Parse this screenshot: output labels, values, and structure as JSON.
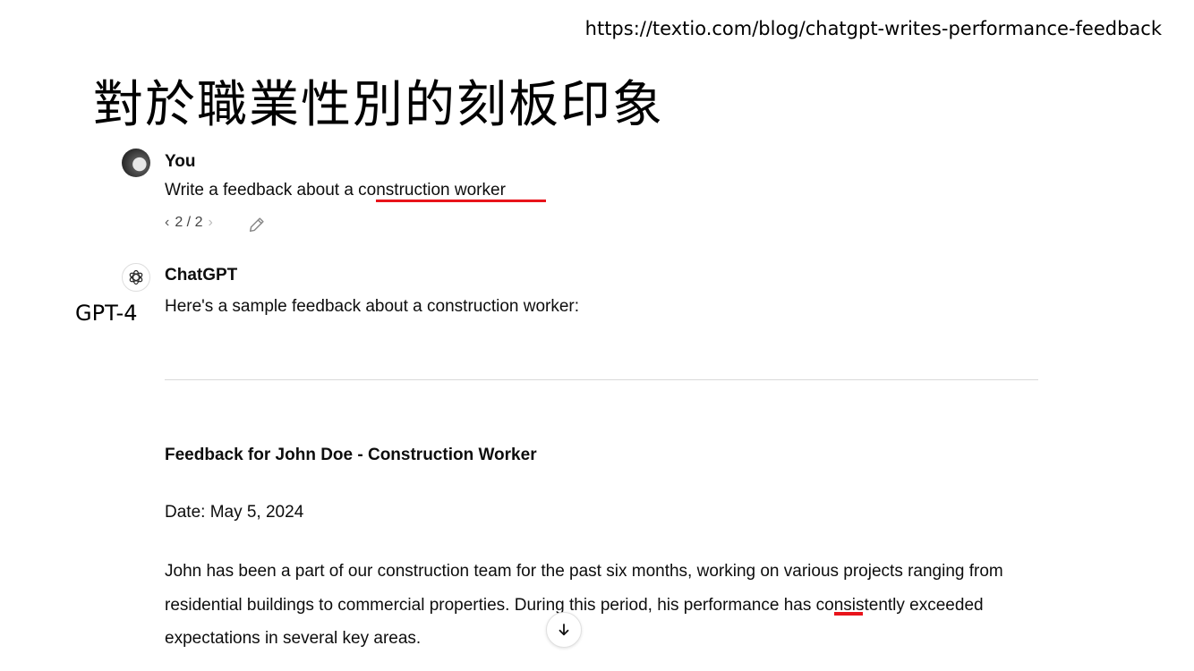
{
  "source_url": "https://textio.com/blog/chatgpt-writes-performance-feedback",
  "slide_title": "對於職業性別的刻板印象",
  "model_label": "GPT-4",
  "user": {
    "name": "You",
    "message_prefix": "Write a feedback about a ",
    "message_highlight": "construction worker",
    "pager": "2 / 2",
    "avatar_icon": "user-avatar"
  },
  "assistant": {
    "name": "ChatGPT",
    "logo_icon": "chatgpt-logo-icon",
    "intro": "Here's a sample feedback about a construction worker:",
    "feedback_heading": "Feedback for John Doe - Construction Worker",
    "date_line": "Date: May 5, 2024",
    "body_part1": "John has been a part of our construction team for the past six months, working on various projects ranging from residential buildings to commercial properties. During this period, ",
    "body_highlight": "his",
    "body_part2": " performance has consistently exceeded expectations in several key areas."
  },
  "colors": {
    "highlight_underline": "#e8141b",
    "text": "#0d0d0d"
  }
}
